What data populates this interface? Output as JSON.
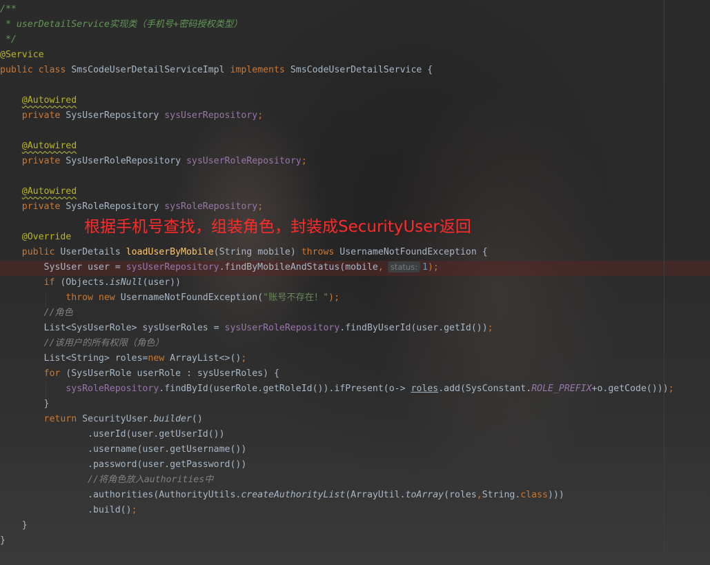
{
  "editor": {
    "lines": [
      [
        {
          "t": "/**",
          "c": "doc"
        }
      ],
      [
        {
          "t": " * userDetailService实现类（手机号+密码授权类型）",
          "c": "doc"
        }
      ],
      [
        {
          "t": " */",
          "c": "doc"
        }
      ],
      [
        {
          "t": "@Service",
          "c": "ann"
        }
      ],
      [
        {
          "t": "public class ",
          "c": "kw"
        },
        {
          "t": "SmsCodeUserDetailServiceImpl ",
          "c": "plain"
        },
        {
          "t": "implements ",
          "c": "kw"
        },
        {
          "t": "SmsCodeUserDetailService {",
          "c": "plain"
        }
      ],
      [],
      [
        {
          "t": "    ",
          "c": "plain"
        },
        {
          "t": "@Autowired",
          "c": "ann squiggle"
        }
      ],
      [
        {
          "t": "    ",
          "c": "plain"
        },
        {
          "t": "private ",
          "c": "kw"
        },
        {
          "t": "SysUserRepository ",
          "c": "plain"
        },
        {
          "t": "sysUserRepository",
          "c": "field"
        },
        {
          "t": ";",
          "c": "kw"
        }
      ],
      [],
      [
        {
          "t": "    ",
          "c": "plain"
        },
        {
          "t": "@Autowired",
          "c": "ann squiggle"
        }
      ],
      [
        {
          "t": "    ",
          "c": "plain"
        },
        {
          "t": "private ",
          "c": "kw"
        },
        {
          "t": "SysUserRoleRepository ",
          "c": "plain"
        },
        {
          "t": "sysUserRoleRepository",
          "c": "field"
        },
        {
          "t": ";",
          "c": "kw"
        }
      ],
      [],
      [
        {
          "t": "    ",
          "c": "plain"
        },
        {
          "t": "@Autowired",
          "c": "ann squiggle"
        }
      ],
      [
        {
          "t": "    ",
          "c": "plain"
        },
        {
          "t": "private ",
          "c": "kw"
        },
        {
          "t": "SysRoleRepository ",
          "c": "plain"
        },
        {
          "t": "sysRoleRepository",
          "c": "field"
        },
        {
          "t": ";",
          "c": "kw"
        }
      ],
      [],
      [
        {
          "t": "    ",
          "c": "plain"
        },
        {
          "t": "@Override",
          "c": "ann"
        }
      ],
      [
        {
          "t": "    ",
          "c": "plain"
        },
        {
          "t": "public ",
          "c": "kw"
        },
        {
          "t": "UserDetails ",
          "c": "plain"
        },
        {
          "t": "loadUserByMobile",
          "c": "fn"
        },
        {
          "t": "(String mobile) ",
          "c": "plain"
        },
        {
          "t": "throws ",
          "c": "kw"
        },
        {
          "t": "UsernameNotFoundException {",
          "c": "plain"
        }
      ],
      [
        {
          "t": "        SysUser user = ",
          "c": "plain"
        },
        {
          "t": "sysUserRepository",
          "c": "field"
        },
        {
          "t": ".findByMobileAndStatus(mobile",
          "c": "plain"
        },
        {
          "t": ",",
          "c": "kw"
        },
        {
          "t": "status:",
          "c": "hint"
        },
        {
          "t": "1",
          "c": "num"
        },
        {
          "t": ");",
          "c": "kw"
        }
      ],
      [
        {
          "t": "        ",
          "c": "plain"
        },
        {
          "t": "if ",
          "c": "kw"
        },
        {
          "t": "(Objects.",
          "c": "plain"
        },
        {
          "t": "isNull",
          "c": "plain static-it"
        },
        {
          "t": "(user))",
          "c": "plain"
        }
      ],
      [
        {
          "t": "            ",
          "c": "plain"
        },
        {
          "t": "throw new ",
          "c": "kw"
        },
        {
          "t": "UsernameNotFoundException(",
          "c": "plain"
        },
        {
          "t": "\"账号不存在！\"",
          "c": "str"
        },
        {
          "t": ");",
          "c": "kw"
        }
      ],
      [
        {
          "t": "        //角色",
          "c": "comment"
        }
      ],
      [
        {
          "t": "        List<SysUserRole> sysUserRoles = ",
          "c": "plain"
        },
        {
          "t": "sysUserRoleRepository",
          "c": "field"
        },
        {
          "t": ".findByUserId(user.getId())",
          "c": "plain"
        },
        {
          "t": ";",
          "c": "kw"
        }
      ],
      [
        {
          "t": "        //该用户的所有权限（角色）",
          "c": "comment"
        }
      ],
      [
        {
          "t": "        List<String> roles=",
          "c": "plain"
        },
        {
          "t": "new ",
          "c": "kw"
        },
        {
          "t": "ArrayList<>()",
          "c": "plain"
        },
        {
          "t": ";",
          "c": "kw"
        }
      ],
      [
        {
          "t": "        ",
          "c": "plain"
        },
        {
          "t": "for ",
          "c": "kw"
        },
        {
          "t": "(SysUserRole userRole : sysUserRoles) {",
          "c": "plain"
        }
      ],
      [
        {
          "t": "            ",
          "c": "plain"
        },
        {
          "t": "sysRoleRepository",
          "c": "field"
        },
        {
          "t": ".findById(userRole.getRoleId()).ifPresent(o-> ",
          "c": "plain"
        },
        {
          "t": "roles",
          "c": "plain ul"
        },
        {
          "t": ".add(SysConstant.",
          "c": "plain"
        },
        {
          "t": "ROLE_PREFIX",
          "c": "const"
        },
        {
          "t": "+o.getCode()))",
          "c": "plain"
        },
        {
          "t": ";",
          "c": "kw"
        }
      ],
      [
        {
          "t": "        }",
          "c": "plain"
        }
      ],
      [
        {
          "t": "        ",
          "c": "plain"
        },
        {
          "t": "return ",
          "c": "kw"
        },
        {
          "t": "SecurityUser.",
          "c": "plain"
        },
        {
          "t": "builder",
          "c": "plain static-it"
        },
        {
          "t": "()",
          "c": "plain"
        }
      ],
      [
        {
          "t": "                .userId(user.getUserId())",
          "c": "plain"
        }
      ],
      [
        {
          "t": "                .username(user.getUsername())",
          "c": "plain"
        }
      ],
      [
        {
          "t": "                .password(user.getPassword())",
          "c": "plain"
        }
      ],
      [
        {
          "t": "                //将角色放入authorities中",
          "c": "comment"
        }
      ],
      [
        {
          "t": "                .authorities(AuthorityUtils.",
          "c": "plain"
        },
        {
          "t": "createAuthorityList",
          "c": "plain static-it"
        },
        {
          "t": "(ArrayUtil.",
          "c": "plain"
        },
        {
          "t": "toArray",
          "c": "plain static-it"
        },
        {
          "t": "(roles",
          "c": "plain"
        },
        {
          "t": ",",
          "c": "kw"
        },
        {
          "t": "String.",
          "c": "plain"
        },
        {
          "t": "class",
          "c": "kw"
        },
        {
          "t": ")))",
          "c": "plain"
        }
      ],
      [
        {
          "t": "                .build()",
          "c": "plain"
        },
        {
          "t": ";",
          "c": "kw"
        }
      ],
      [
        {
          "t": "    }",
          "c": "plain"
        }
      ],
      [
        {
          "t": "}",
          "c": "plain"
        }
      ]
    ]
  },
  "annotation_text": "根据手机号查找，组装角色，封装成SecurityUser返回",
  "colors": {
    "background": "#2b2b2b",
    "keyword": "#cc7832",
    "field": "#9876aa",
    "annotation": "#bbb529",
    "method": "#ffc66d",
    "string": "#6a8759",
    "number": "#6897bb",
    "comment": "#808080",
    "doc_comment": "#629755",
    "overlay_note": "#ff2a2a"
  }
}
